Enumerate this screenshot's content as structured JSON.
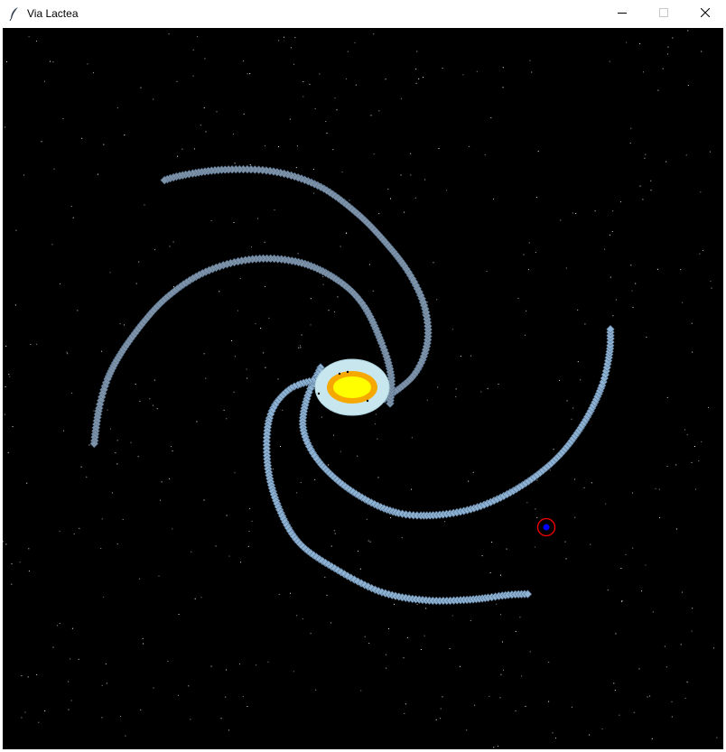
{
  "window": {
    "title": "Via Lactea",
    "icons": {
      "app": "feather-icon",
      "minimize": "minimize-icon",
      "maximize": "maximize-icon",
      "close": "close-icon"
    }
  },
  "canvas": {
    "background": "#000000",
    "colors": {
      "star": "#ffffff",
      "arm_light": "#8eb3d4",
      "arm_dark": "#7f93a8",
      "halo": "#c7e6ee",
      "bulge_outer": "#f5a800",
      "bulge_inner": "#ffff00",
      "marker_ring": "#ff0000",
      "marker_dot": "#0000ff"
    }
  }
}
